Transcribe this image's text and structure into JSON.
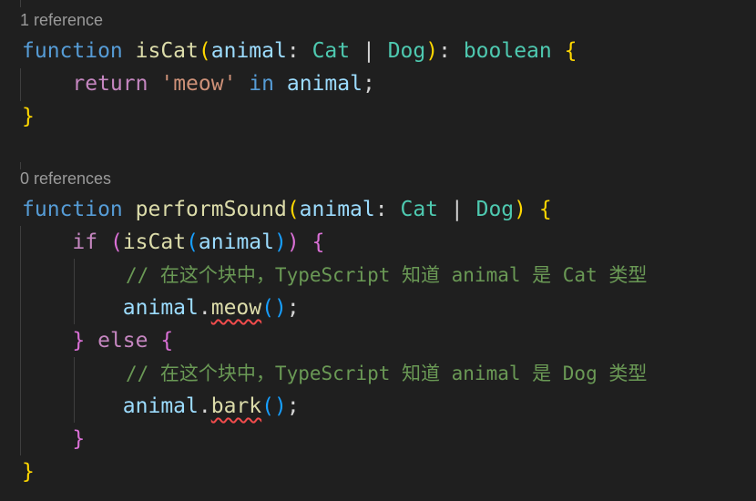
{
  "lens": {
    "ref1": "1 reference",
    "ref0": "0 references"
  },
  "code": {
    "l1": {
      "kw": "function",
      "fn": "isCat",
      "po": "(",
      "param": "animal",
      "colon": ":",
      "type1": "Cat",
      "bar": "|",
      "type2": "Dog",
      "pc": ")",
      "colon2": ":",
      "ret_type": "boolean",
      "brace": "{"
    },
    "l2": {
      "kw": "return",
      "str": "'meow'",
      "op": "in",
      "id": "animal",
      "semi": ";"
    },
    "l3": {
      "brace": "}"
    },
    "l4": {
      "kw": "function",
      "fn": "performSound",
      "po": "(",
      "param": "animal",
      "colon": ":",
      "type1": "Cat",
      "bar": "|",
      "type2": "Dog",
      "pc": ")",
      "brace": "{"
    },
    "l5": {
      "kw": "if",
      "po": "(",
      "fn": "isCat",
      "po2": "(",
      "id": "animal",
      "pc2": ")",
      "pc": ")",
      "brace": "{"
    },
    "l6": {
      "comment": "// 在这个块中，TypeScript 知道 animal 是 Cat 类型"
    },
    "l7": {
      "obj": "animal",
      "dot": ".",
      "method": "meow",
      "po": "(",
      "pc": ")",
      "semi": ";"
    },
    "l8": {
      "brace_close": "}",
      "kw": "else",
      "brace": "{"
    },
    "l9": {
      "comment": "// 在这个块中，TypeScript 知道 animal 是 Dog 类型"
    },
    "l10": {
      "obj": "animal",
      "dot": ".",
      "method": "bark",
      "po": "(",
      "pc": ")",
      "semi": ";"
    },
    "l11": {
      "brace": "}"
    },
    "l12": {
      "brace": "}"
    }
  }
}
